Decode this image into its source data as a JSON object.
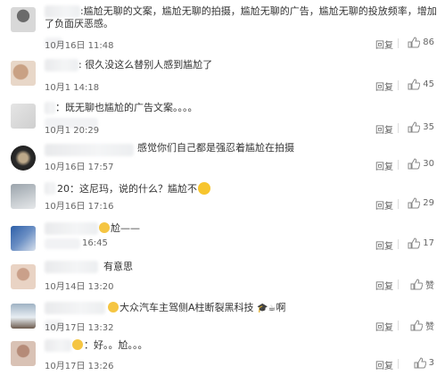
{
  "comments": [
    {
      "text": ":尴尬无聊的文案，尴尬无聊的拍摄，尴尬无聊的广告，尴尬无聊的投放频率，增加了负面厌恶感。",
      "date": "10月16日 11:48",
      "reply": "回复",
      "likes": "86"
    },
    {
      "text": ": 很久没这么替别人感到尴尬了",
      "date": "10月1  14:18",
      "reply": "回复",
      "likes": "45"
    },
    {
      "text": "：既无聊也尴尬的广告文案。。。。",
      "date": "10月1  20:29",
      "reply": "回复",
      "likes": "35"
    },
    {
      "text": "感觉你们自己都是强忍着尴尬在拍摄",
      "date": "10月16日 17:57",
      "reply": "回复",
      "likes": "30"
    },
    {
      "text": "20：这尼玛，说的什么？尴尬不",
      "date": "10月16日 17:16",
      "reply": "回复",
      "likes": "29"
    },
    {
      "text": "尬——",
      "date": "16:45",
      "reply": "回复",
      "likes": "17"
    },
    {
      "text": "有意思",
      "date": "10月14日 13:20",
      "reply": "回复",
      "likes": "赞"
    },
    {
      "text": "大众汽车主驾侧A柱断裂黑科技",
      "text_tail": "啊",
      "date": "10月17日 13:32",
      "reply": "回复",
      "likes": "赞"
    },
    {
      "text": "：好。。尬。。。",
      "date": "10月17日 13:26",
      "reply": "回复",
      "likes": "3"
    }
  ]
}
